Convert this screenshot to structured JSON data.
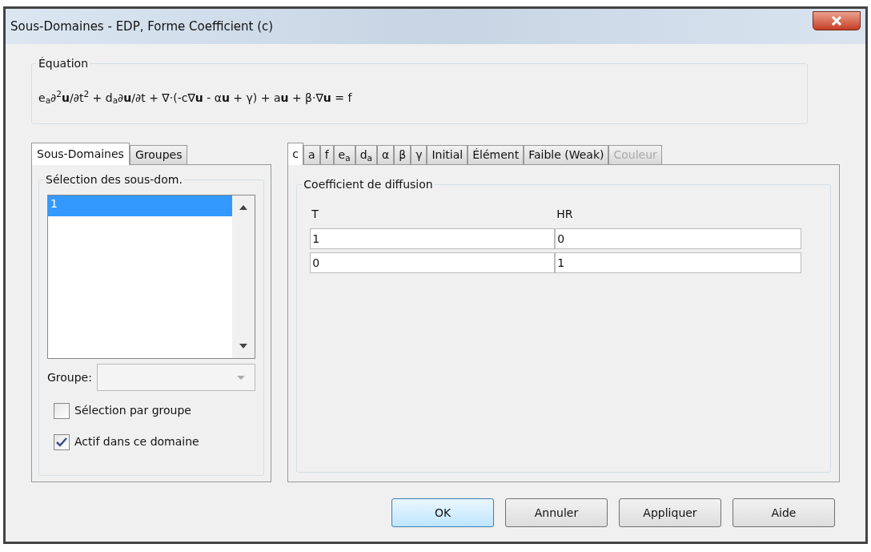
{
  "window": {
    "title": "Sous-Domaines - EDP, Forme Coefficient (c)"
  },
  "equation": {
    "label": "Équation",
    "formula": "e$_{a}$∂$^{2}$**u**/∂t$^{2}$ + d$_{a}$∂**u**/∂t + ∇·(-c∇**u** - α**u** + γ) + a**u** + β·∇**u** = f"
  },
  "left_tabs": [
    {
      "label": "Sous-Domaines",
      "selected": true
    },
    {
      "label": "Groupes",
      "selected": false
    }
  ],
  "selection": {
    "label": "Sélection des sous-dom.",
    "items": [
      {
        "label": "1",
        "selected": true
      }
    ]
  },
  "group_field": {
    "label": "Groupe:"
  },
  "checkboxes": [
    {
      "label": "Sélection par groupe",
      "checked": false
    },
    {
      "label": "Actif dans ce domaine",
      "checked": true
    }
  ],
  "right_tabs": [
    {
      "label": "c",
      "selected": true,
      "disabled": false
    },
    {
      "label": "a",
      "selected": false,
      "disabled": false
    },
    {
      "label": "f",
      "selected": false,
      "disabled": false
    },
    {
      "label": "e$_{a}$",
      "selected": false,
      "disabled": false
    },
    {
      "label": "d$_{a}$",
      "selected": false,
      "disabled": false
    },
    {
      "label": "α",
      "selected": false,
      "disabled": false
    },
    {
      "label": "β",
      "selected": false,
      "disabled": false
    },
    {
      "label": "γ",
      "selected": false,
      "disabled": false
    },
    {
      "label": "Initial",
      "selected": false,
      "disabled": false
    },
    {
      "label": "Élément",
      "selected": false,
      "disabled": false
    },
    {
      "label": "Faible (Weak)",
      "selected": false,
      "disabled": false
    },
    {
      "label": "Couleur",
      "selected": false,
      "disabled": true
    }
  ],
  "coefficient": {
    "label": "Coefficient de diffusion",
    "columns": [
      "T",
      "HR"
    ],
    "rows": [
      [
        "1",
        "0"
      ],
      [
        "0",
        "1"
      ]
    ]
  },
  "buttons": [
    {
      "label": "OK",
      "default": true
    },
    {
      "label": "Annuler",
      "default": false
    },
    {
      "label": "Appliquer",
      "default": false
    },
    {
      "label": "Aide",
      "default": false
    }
  ]
}
